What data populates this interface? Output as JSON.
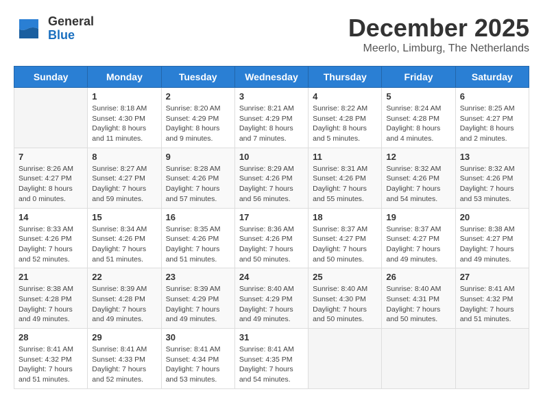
{
  "header": {
    "logo_general": "General",
    "logo_blue": "Blue",
    "month": "December 2025",
    "location": "Meerlo, Limburg, The Netherlands"
  },
  "weekdays": [
    "Sunday",
    "Monday",
    "Tuesday",
    "Wednesday",
    "Thursday",
    "Friday",
    "Saturday"
  ],
  "weeks": [
    [
      {
        "day": "",
        "info": ""
      },
      {
        "day": "1",
        "info": "Sunrise: 8:18 AM\nSunset: 4:30 PM\nDaylight: 8 hours\nand 11 minutes."
      },
      {
        "day": "2",
        "info": "Sunrise: 8:20 AM\nSunset: 4:29 PM\nDaylight: 8 hours\nand 9 minutes."
      },
      {
        "day": "3",
        "info": "Sunrise: 8:21 AM\nSunset: 4:29 PM\nDaylight: 8 hours\nand 7 minutes."
      },
      {
        "day": "4",
        "info": "Sunrise: 8:22 AM\nSunset: 4:28 PM\nDaylight: 8 hours\nand 5 minutes."
      },
      {
        "day": "5",
        "info": "Sunrise: 8:24 AM\nSunset: 4:28 PM\nDaylight: 8 hours\nand 4 minutes."
      },
      {
        "day": "6",
        "info": "Sunrise: 8:25 AM\nSunset: 4:27 PM\nDaylight: 8 hours\nand 2 minutes."
      }
    ],
    [
      {
        "day": "7",
        "info": "Sunrise: 8:26 AM\nSunset: 4:27 PM\nDaylight: 8 hours\nand 0 minutes."
      },
      {
        "day": "8",
        "info": "Sunrise: 8:27 AM\nSunset: 4:27 PM\nDaylight: 7 hours\nand 59 minutes."
      },
      {
        "day": "9",
        "info": "Sunrise: 8:28 AM\nSunset: 4:26 PM\nDaylight: 7 hours\nand 57 minutes."
      },
      {
        "day": "10",
        "info": "Sunrise: 8:29 AM\nSunset: 4:26 PM\nDaylight: 7 hours\nand 56 minutes."
      },
      {
        "day": "11",
        "info": "Sunrise: 8:31 AM\nSunset: 4:26 PM\nDaylight: 7 hours\nand 55 minutes."
      },
      {
        "day": "12",
        "info": "Sunrise: 8:32 AM\nSunset: 4:26 PM\nDaylight: 7 hours\nand 54 minutes."
      },
      {
        "day": "13",
        "info": "Sunrise: 8:32 AM\nSunset: 4:26 PM\nDaylight: 7 hours\nand 53 minutes."
      }
    ],
    [
      {
        "day": "14",
        "info": "Sunrise: 8:33 AM\nSunset: 4:26 PM\nDaylight: 7 hours\nand 52 minutes."
      },
      {
        "day": "15",
        "info": "Sunrise: 8:34 AM\nSunset: 4:26 PM\nDaylight: 7 hours\nand 51 minutes."
      },
      {
        "day": "16",
        "info": "Sunrise: 8:35 AM\nSunset: 4:26 PM\nDaylight: 7 hours\nand 51 minutes."
      },
      {
        "day": "17",
        "info": "Sunrise: 8:36 AM\nSunset: 4:26 PM\nDaylight: 7 hours\nand 50 minutes."
      },
      {
        "day": "18",
        "info": "Sunrise: 8:37 AM\nSunset: 4:27 PM\nDaylight: 7 hours\nand 50 minutes."
      },
      {
        "day": "19",
        "info": "Sunrise: 8:37 AM\nSunset: 4:27 PM\nDaylight: 7 hours\nand 49 minutes."
      },
      {
        "day": "20",
        "info": "Sunrise: 8:38 AM\nSunset: 4:27 PM\nDaylight: 7 hours\nand 49 minutes."
      }
    ],
    [
      {
        "day": "21",
        "info": "Sunrise: 8:38 AM\nSunset: 4:28 PM\nDaylight: 7 hours\nand 49 minutes."
      },
      {
        "day": "22",
        "info": "Sunrise: 8:39 AM\nSunset: 4:28 PM\nDaylight: 7 hours\nand 49 minutes."
      },
      {
        "day": "23",
        "info": "Sunrise: 8:39 AM\nSunset: 4:29 PM\nDaylight: 7 hours\nand 49 minutes."
      },
      {
        "day": "24",
        "info": "Sunrise: 8:40 AM\nSunset: 4:29 PM\nDaylight: 7 hours\nand 49 minutes."
      },
      {
        "day": "25",
        "info": "Sunrise: 8:40 AM\nSunset: 4:30 PM\nDaylight: 7 hours\nand 50 minutes."
      },
      {
        "day": "26",
        "info": "Sunrise: 8:40 AM\nSunset: 4:31 PM\nDaylight: 7 hours\nand 50 minutes."
      },
      {
        "day": "27",
        "info": "Sunrise: 8:41 AM\nSunset: 4:32 PM\nDaylight: 7 hours\nand 51 minutes."
      }
    ],
    [
      {
        "day": "28",
        "info": "Sunrise: 8:41 AM\nSunset: 4:32 PM\nDaylight: 7 hours\nand 51 minutes."
      },
      {
        "day": "29",
        "info": "Sunrise: 8:41 AM\nSunset: 4:33 PM\nDaylight: 7 hours\nand 52 minutes."
      },
      {
        "day": "30",
        "info": "Sunrise: 8:41 AM\nSunset: 4:34 PM\nDaylight: 7 hours\nand 53 minutes."
      },
      {
        "day": "31",
        "info": "Sunrise: 8:41 AM\nSunset: 4:35 PM\nDaylight: 7 hours\nand 54 minutes."
      },
      {
        "day": "",
        "info": ""
      },
      {
        "day": "",
        "info": ""
      },
      {
        "day": "",
        "info": ""
      }
    ]
  ]
}
